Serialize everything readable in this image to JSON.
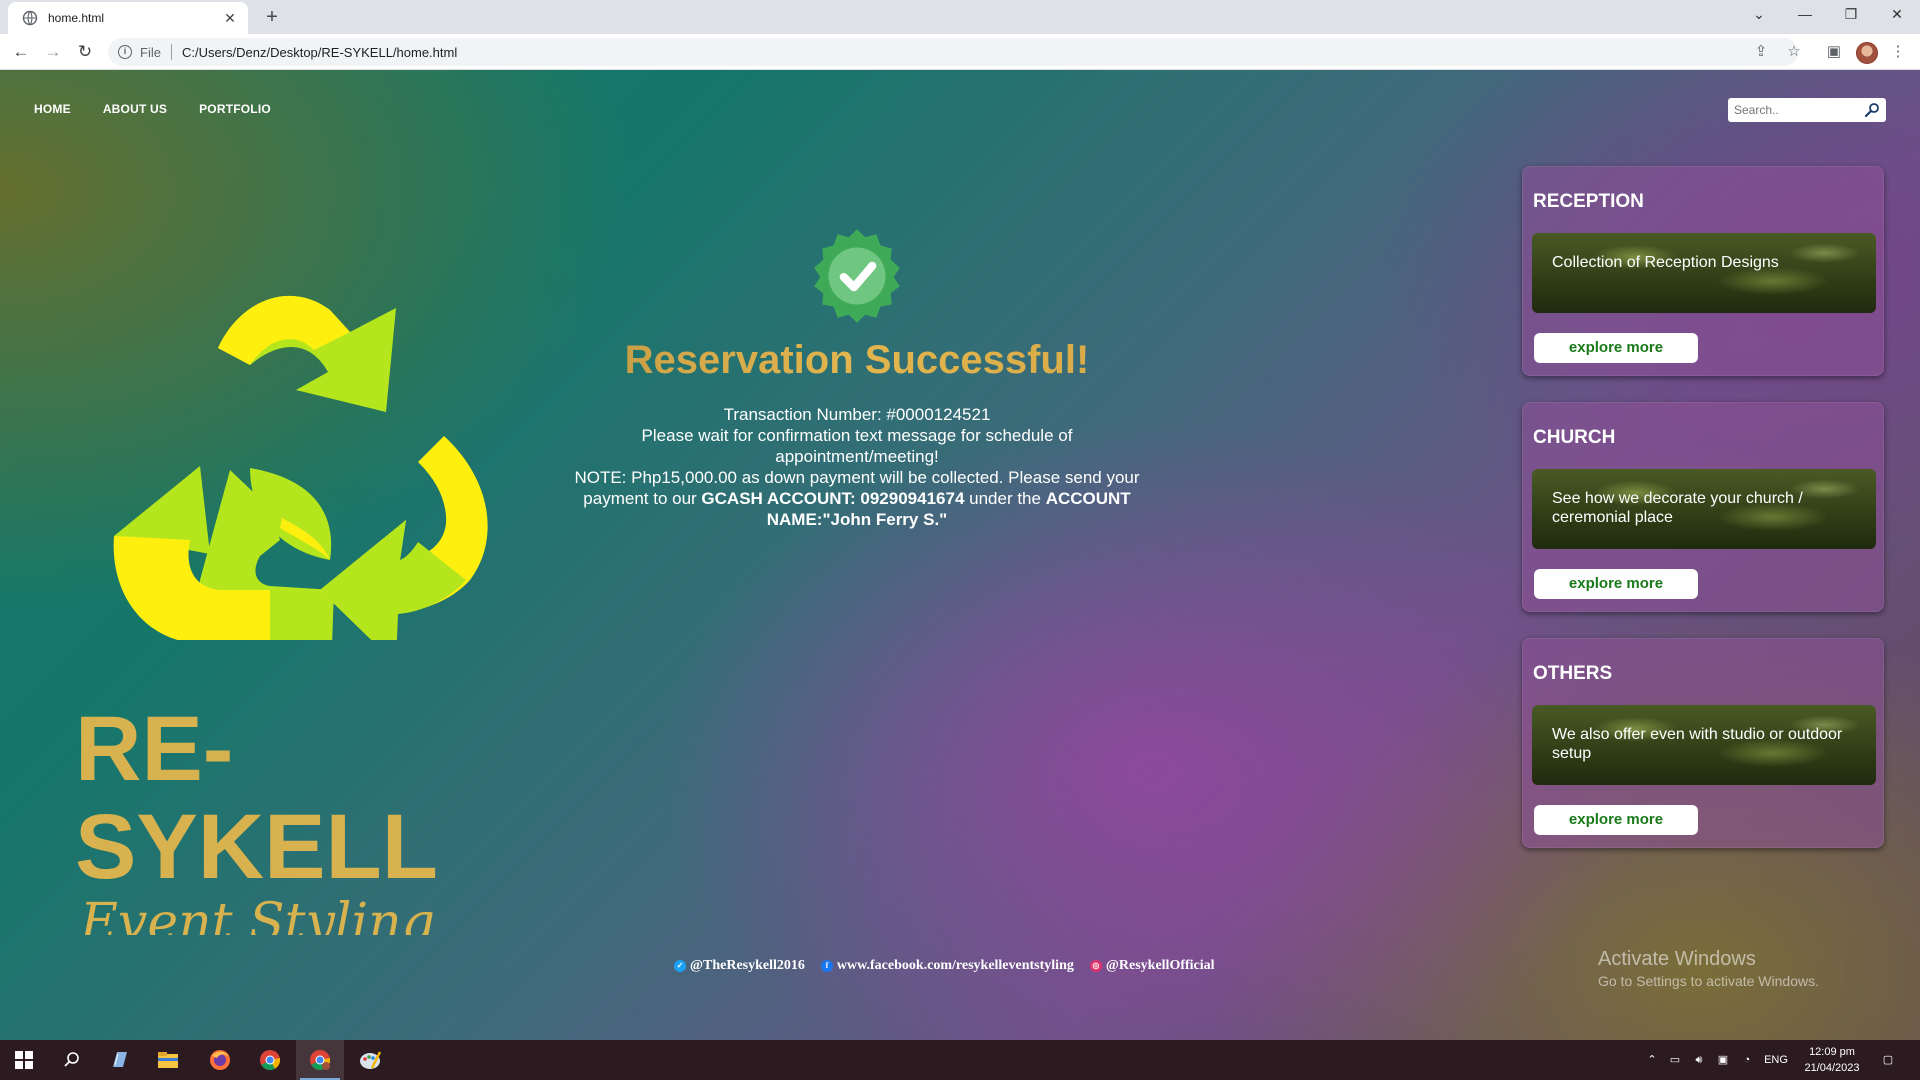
{
  "browser": {
    "tab_title": "home.html",
    "new_tab": "+",
    "scheme": "File",
    "url": "C:/Users/Denz/Desktop/RE-SYKELL/home.html"
  },
  "nav": {
    "home": "HOME",
    "about": "ABOUT US",
    "portfolio": "PORTFOLIO"
  },
  "search": {
    "placeholder": "Search.."
  },
  "brand": {
    "title_line1": "RE-",
    "title_line2": "SYKELL",
    "subtitle": "Event Styling"
  },
  "message": {
    "title": "Reservation Successful!",
    "line1": "Transaction Number: #0000124521",
    "line2": "Please wait for confirmation text message for schedule of appointment/meeting!",
    "line3_a": "NOTE: Php15,000.00 as down payment will be collected. Please send your payment to our ",
    "line3_b": "GCASH ACCOUNT: 09290941674",
    "line3_c": " under the ",
    "line3_d": "ACCOUNT NAME:\"John Ferry S.\""
  },
  "cards": [
    {
      "title": "RECEPTION",
      "caption": "Collection of Reception Designs",
      "button": "explore more"
    },
    {
      "title": "CHURCH",
      "caption": "See how we decorate your church / ceremonial place",
      "button": "explore more"
    },
    {
      "title": "OTHERS",
      "caption": "We also offer even with studio or outdoor setup",
      "button": "explore more"
    }
  ],
  "socials": {
    "twitter": "@TheResykell2016",
    "facebook": "www.facebook.com/resykelleventstyling",
    "instagram": "@ResykellOfficial"
  },
  "watermark": {
    "line1": "Activate Windows",
    "line2": "Go to Settings to activate Windows."
  },
  "taskbar": {
    "lang": "ENG",
    "time": "12:09 pm",
    "date": "21/04/2023"
  },
  "colors": {
    "gold": "#d8b24e",
    "leaf_green": "#b5e61d",
    "leaf_yellow": "#ffef0f",
    "badge_green": "#3ea956",
    "button_text": "#1a7a1a"
  }
}
